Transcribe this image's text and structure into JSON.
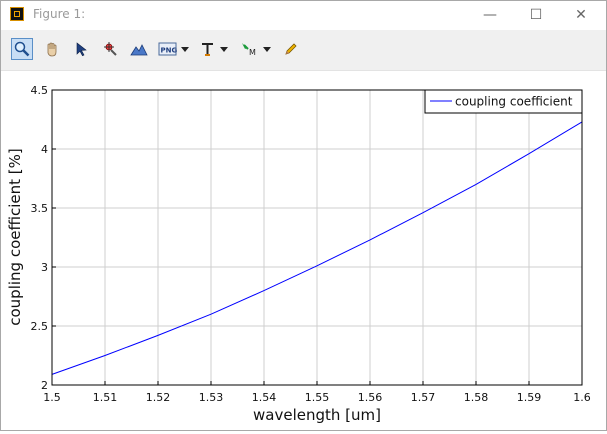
{
  "window": {
    "title": "Figure 1:",
    "minimize_icon": "minimize-icon",
    "maximize_icon": "maximize-icon",
    "close_icon": "close-icon"
  },
  "toolbar": {
    "tools": [
      "zoom-icon",
      "pan-hand-icon",
      "select-arrow-icon",
      "data-cursor-icon",
      "mountain-view-icon",
      "save-png-icon",
      "text-annotate-icon",
      "marker-icon",
      "pencil-icon"
    ]
  },
  "chart_data": {
    "type": "line",
    "xlabel": "wavelength [um]",
    "ylabel": "coupling coefficient [%]",
    "xlim": [
      1.5,
      1.6
    ],
    "ylim": [
      2,
      4.5
    ],
    "x_ticks": [
      "1.5",
      "1.51",
      "1.52",
      "1.53",
      "1.54",
      "1.55",
      "1.56",
      "1.57",
      "1.58",
      "1.59",
      "1.6"
    ],
    "y_ticks": [
      "2",
      "2.5",
      "3",
      "3.5",
      "4",
      "4.5"
    ],
    "grid": true,
    "legend_position": "top-right",
    "series": [
      {
        "name": "coupling coefficient",
        "color": "#0000ff",
        "x": [
          1.5,
          1.51,
          1.52,
          1.53,
          1.54,
          1.55,
          1.56,
          1.57,
          1.58,
          1.59,
          1.6
        ],
        "y": [
          2.09,
          2.25,
          2.42,
          2.6,
          2.8,
          3.01,
          3.23,
          3.46,
          3.7,
          3.96,
          4.23
        ]
      }
    ]
  }
}
